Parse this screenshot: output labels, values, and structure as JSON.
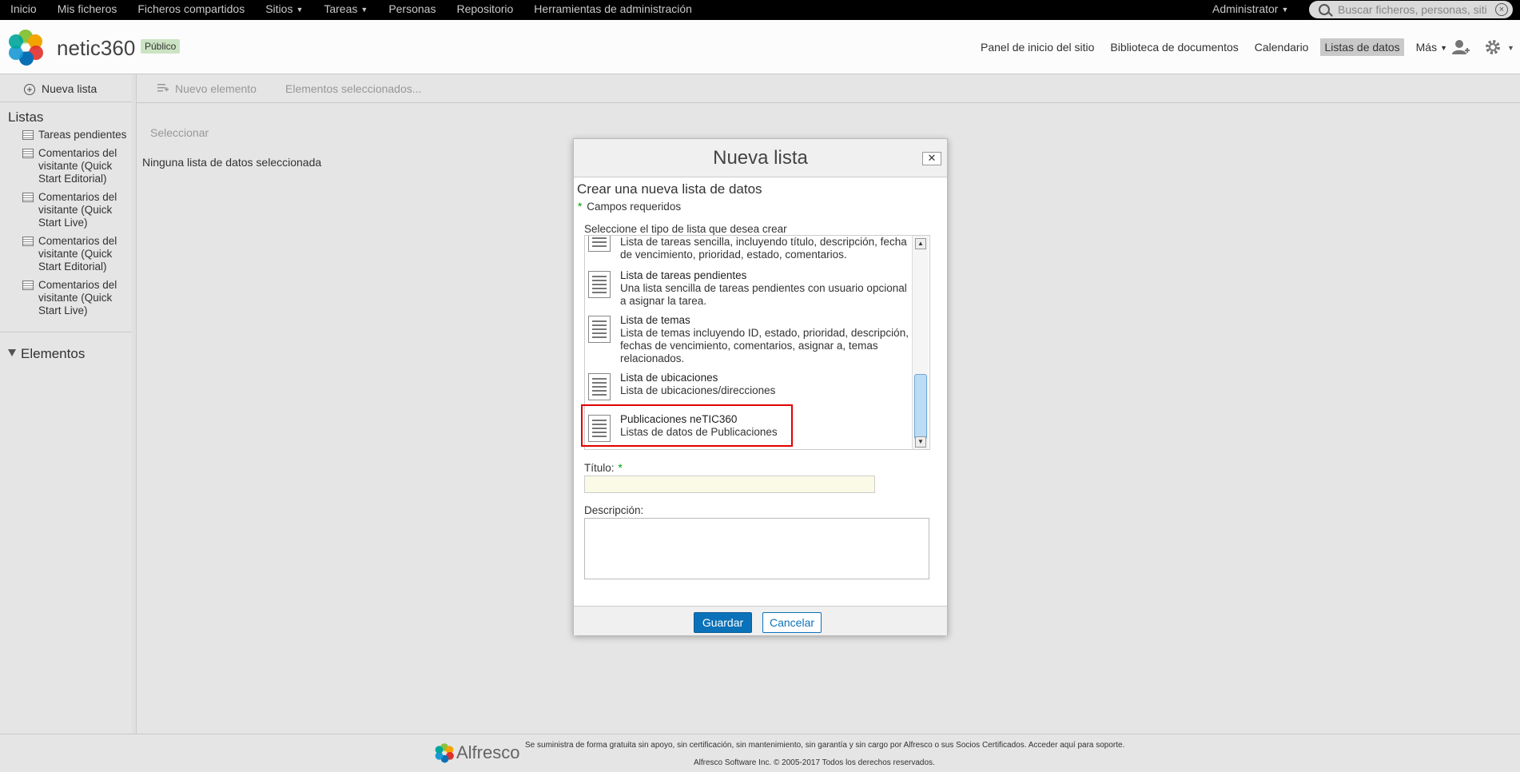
{
  "topbar": {
    "nav": [
      "Inicio",
      "Mis ficheros",
      "Ficheros compartidos",
      "Sitios",
      "Tareas",
      "Personas",
      "Repositorio",
      "Herramientas de administración"
    ],
    "user": "Administrator",
    "search_placeholder": "Buscar ficheros, personas, siti"
  },
  "header": {
    "site_title": "netic360",
    "badge": "Público",
    "nav": [
      "Panel de inicio del sitio",
      "Biblioteca de documentos",
      "Calendario",
      "Listas de datos",
      "Más"
    ],
    "active_nav": "Listas de datos"
  },
  "sidebar": {
    "new_list": "Nueva lista",
    "lists_heading": "Listas",
    "lists": [
      "Tareas pendientes",
      "Comentarios del visitante (Quick Start Editorial)",
      "Comentarios del visitante (Quick Start Live)",
      "Comentarios del visitante (Quick Start Editorial)",
      "Comentarios del visitante (Quick Start Live)"
    ],
    "elements_heading": "Elementos"
  },
  "main": {
    "toolbar": {
      "new_item": "Nuevo elemento",
      "selected_items": "Elementos seleccionados..."
    },
    "select_label": "Seleccionar",
    "no_list": "Ninguna lista de datos seleccionada"
  },
  "dialog": {
    "title": "Nueva lista",
    "subtitle": "Crear una nueva lista de datos",
    "required": "Campos requeridos",
    "type_label": "Seleccione el tipo de lista que desea crear",
    "types": [
      {
        "name": "",
        "desc": "Lista de tareas sencilla, incluyendo título, descripción, fecha de vencimiento, prioridad, estado, comentarios."
      },
      {
        "name": "Lista de tareas pendientes",
        "desc": "Una lista sencilla de tareas pendientes con usuario opcional a asignar la tarea."
      },
      {
        "name": "Lista de temas",
        "desc": "Lista de temas incluyendo ID, estado, prioridad, descripción, fechas de vencimiento, comentarios, asignar a, temas relacionados."
      },
      {
        "name": "Lista de ubicaciones",
        "desc": "Lista de ubicaciones/direcciones"
      },
      {
        "name": "Publicaciones neTIC360",
        "desc": "Listas de datos de Publicaciones"
      }
    ],
    "title_label": "Título:",
    "desc_label": "Descripción:",
    "save": "Guardar",
    "cancel": "Cancelar"
  },
  "footer": {
    "brand": "Alfresco",
    "line1": "Se suministra de forma gratuita sin apoyo, sin certificación, sin mantenimiento, sin garantía y sin cargo por Alfresco o sus Socios Certificados. Acceder aquí para soporte.",
    "line2": "Alfresco Software Inc. © 2005-2017 Todos los derechos reservados."
  },
  "colors": {
    "primary_button": "#0b72b9",
    "highlight_border": "#e00000",
    "required_asterisk": "#00a000"
  }
}
